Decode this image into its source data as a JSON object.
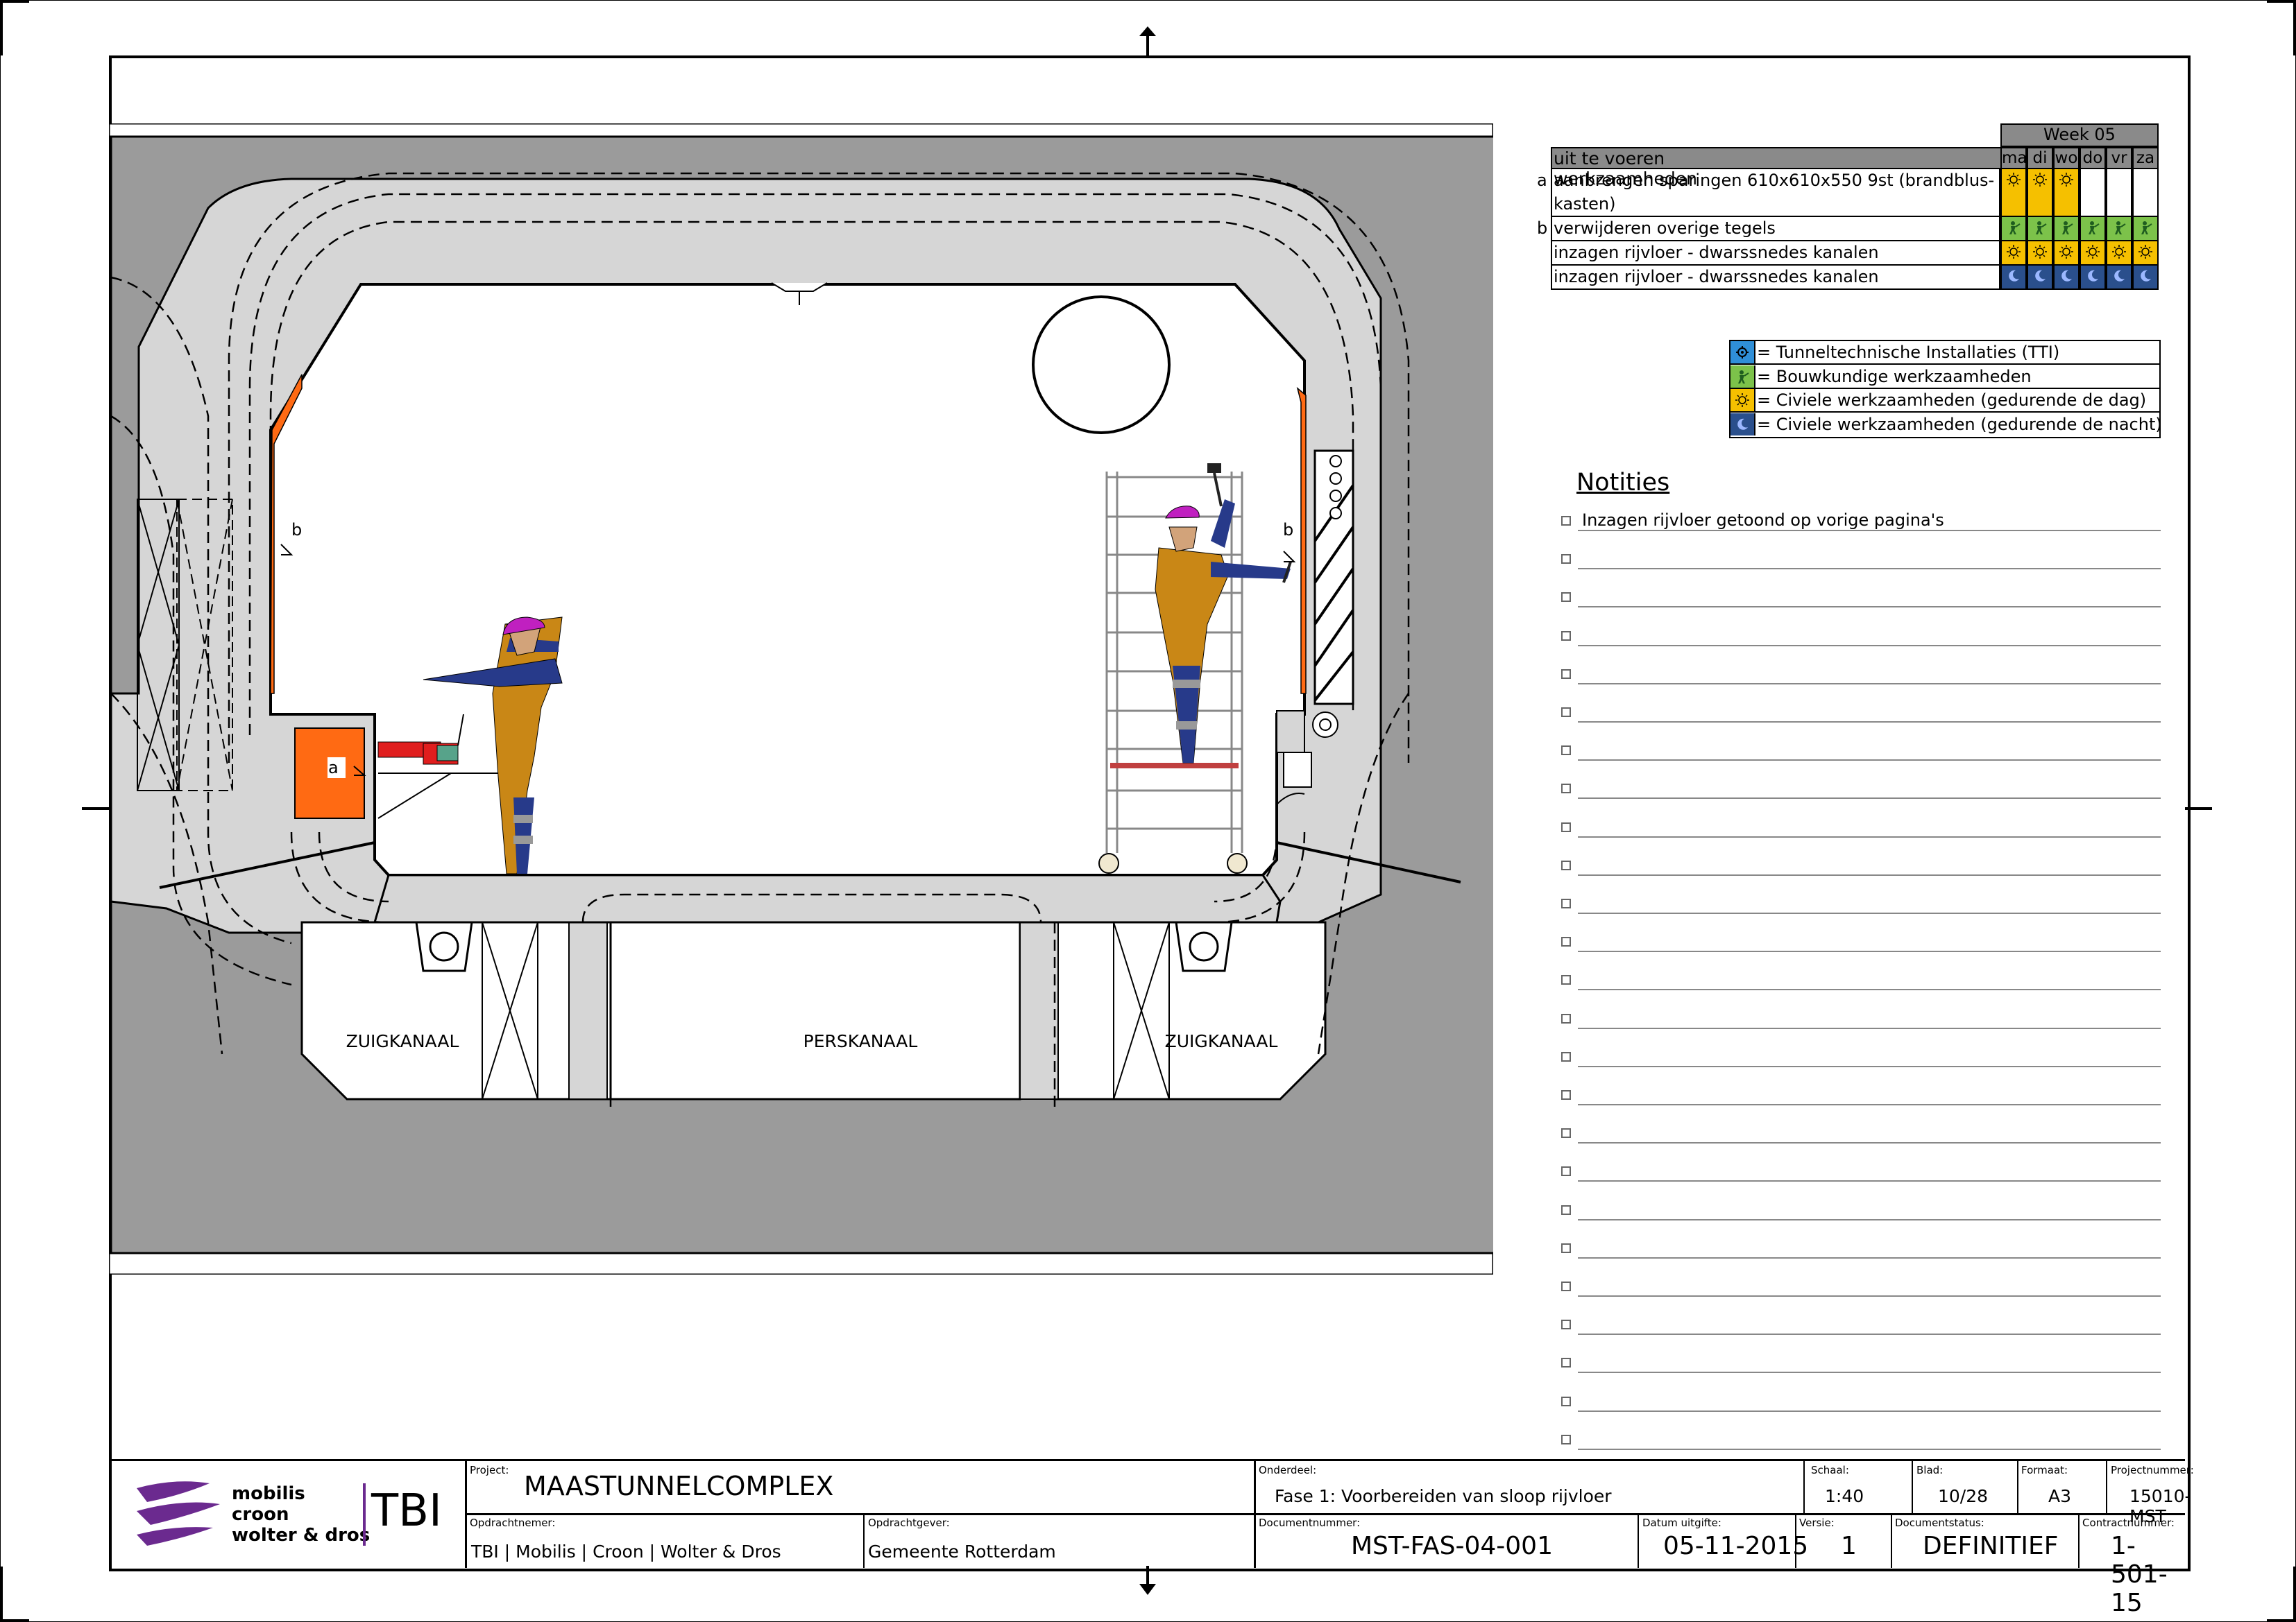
{
  "schedule": {
    "week_label": "Week 05",
    "header_label": "uit te voeren werkzaamheden",
    "days": [
      "ma",
      "di",
      "wo",
      "do",
      "vr",
      "za"
    ],
    "rows": [
      {
        "key": "a",
        "text": "aanbrengen sparingen 610x610x550 9st (brandblus-",
        "text2": "kasten)",
        "cells": [
          "sun",
          "sun",
          "sun",
          "",
          "",
          ""
        ]
      },
      {
        "key": "b",
        "text": "verwijderen overige tegels",
        "text2": "",
        "cells": [
          "worker",
          "worker",
          "worker",
          "worker",
          "worker",
          "worker"
        ]
      },
      {
        "key": "",
        "text": "inzagen rijvloer - dwarssnedes kanalen",
        "text2": "",
        "cells": [
          "sun",
          "sun",
          "sun",
          "sun",
          "sun",
          "sun"
        ]
      },
      {
        "key": "",
        "text": "inzagen rijvloer - dwarssnedes kanalen",
        "text2": "",
        "cells": [
          "moon",
          "moon",
          "moon",
          "moon",
          "moon",
          "moon"
        ]
      }
    ]
  },
  "legend": [
    {
      "icon": "gear-icon",
      "color": "#2f8fd8",
      "label": "= Tunneltechnische Installaties (TTI)"
    },
    {
      "icon": "worker-icon",
      "color": "#7cc24a",
      "label": "= Bouwkundige werkzaamheden"
    },
    {
      "icon": "sun-icon",
      "color": "#f5c000",
      "label": "= Civiele werkzaamheden (gedurende de dag)"
    },
    {
      "icon": "moon-icon",
      "color": "#2a4f8c",
      "label": "= Civiele werkzaamheden (gedurende de nacht)"
    }
  ],
  "notes": {
    "title": "Notities",
    "first_note": "Inzagen rijvloer getoond op vorige pagina's",
    "empty_lines": 24
  },
  "drawing": {
    "channel_left": "ZUIGKANAAL",
    "channel_middle": "PERSKANAAL",
    "channel_right": "ZUIGKANAAL",
    "marker_a": "a",
    "marker_b_left": "b",
    "marker_b_right": "b"
  },
  "title_block": {
    "logo_line1": "mobilis",
    "logo_line2": "croon",
    "logo_line3": "wolter & dros",
    "logo_tbi": "TBI",
    "project_label": "Project:",
    "project": "MAASTUNNELCOMPLEX",
    "onderdeel_label": "Onderdeel:",
    "onderdeel": "Fase 1: Voorbereiden van sloop rijvloer",
    "schaal_label": "Schaal:",
    "schaal": "1:40",
    "blad_label": "Blad:",
    "blad": "10/28",
    "formaat_label": "Formaat:",
    "formaat": "A3",
    "projectnummer_label": "Projectnummer:",
    "projectnummer": "15010-MST",
    "opdrachtnemer_label": "Opdrachtnemer:",
    "opdrachtnemer": [
      "TBI",
      "Mobilis",
      "Croon",
      "Wolter & Dros"
    ],
    "opdrachtgever_label": "Opdrachtgever:",
    "opdrachtgever": "Gemeente Rotterdam",
    "documentnummer_label": "Documentnummer:",
    "documentnummer": "MST-FAS-04-001",
    "datum_label": "Datum uitgifte:",
    "datum": "05-11-2015",
    "versie_label": "Versie:",
    "versie": "1",
    "status_label": "Documentstatus:",
    "status": "DEFINITIEF",
    "contract_label": "Contractnummer:",
    "contract": "1-501-15"
  },
  "colors": {
    "concrete_bg": "#9b9b9b",
    "concrete_light": "#d6d6d6",
    "orange": "#ff6a13",
    "worker_body": "#c98716",
    "worker_blue": "#273a8a",
    "helmet": "#c020c0",
    "grid_header": "#8a8a8a",
    "sun_cell": "#f5c000",
    "green_cell": "#7cc24a",
    "moon_cell": "#2a4f8c"
  }
}
